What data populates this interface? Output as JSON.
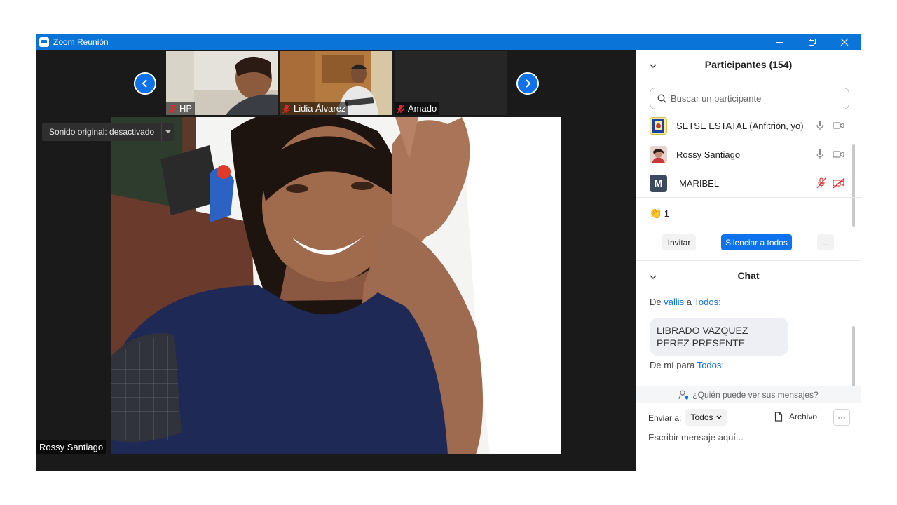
{
  "window": {
    "title": "Zoom Reunión",
    "controls": [
      "minimize-icon",
      "restore-icon",
      "close-icon"
    ]
  },
  "video": {
    "thumbnails": [
      {
        "name": "HP",
        "muted": true
      },
      {
        "name": "Lidia Álvarez",
        "muted": true
      },
      {
        "name": "Amado",
        "muted": true
      }
    ],
    "sound_original": "Sonido original: desactivado",
    "active_speaker": "Rossy Santiago"
  },
  "participants": {
    "header": "Participantes (154)",
    "search_placeholder": "Buscar un participante",
    "list": [
      {
        "name": "SETSE ESTATAL (Anfitrión, yo)",
        "mic": "on",
        "camera": "on"
      },
      {
        "name": "Rossy Santiago",
        "mic": "on",
        "camera": "on"
      },
      {
        "name": "MARIBEL",
        "avatar_letter": "M",
        "mic": "muted",
        "camera": "off"
      }
    ],
    "reaction": {
      "icon": "clapping-hands-icon",
      "emoji": "👏",
      "count": "1"
    },
    "buttons": {
      "invite": "Invitar",
      "mute_all": "Silenciar a todos",
      "more": "..."
    }
  },
  "chat": {
    "header": "Chat",
    "messages": [
      {
        "from_prefix": "De",
        "from": "vallis",
        "to_prefix": "a",
        "to": "Todos:",
        "text": "LIBRADO VAZQUEZ PEREZ PRESENTE"
      },
      {
        "from_prefix": "De mí para",
        "to": "Todos:"
      }
    ],
    "who_can_see": "¿Quién puede ver sus mensajes?",
    "send_to_label": "Enviar a:",
    "send_to_value": "Todos",
    "file_label": "Archivo",
    "more_label": "···",
    "input_placeholder": "Escribir mensaje aquí..."
  },
  "colors": {
    "titlebar": "#0b74d8",
    "accent": "#0e72ed",
    "muted_red": "#e02828"
  }
}
